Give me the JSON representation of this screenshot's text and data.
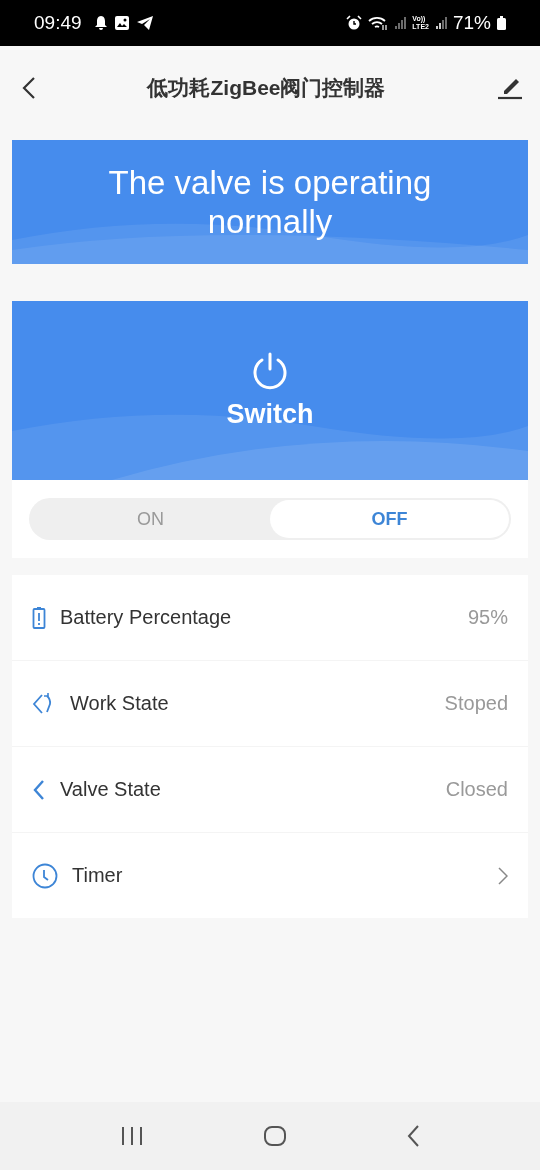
{
  "status_bar": {
    "time": "09:49",
    "network_label_top": "Vo))",
    "network_label_bottom": "LTE2",
    "battery": "71%"
  },
  "header": {
    "title": "低功耗ZigBee阀门控制器"
  },
  "banner": {
    "message": "The valve is operating normally"
  },
  "switch_card": {
    "label": "Switch"
  },
  "toggle": [
    {
      "label": "ON",
      "selected": false
    },
    {
      "label": "OFF",
      "selected": true
    }
  ],
  "rows": [
    {
      "kind": "value",
      "label": "Battery Percentage",
      "value": "95%"
    },
    {
      "kind": "value",
      "label": "Work State",
      "value": "Stoped"
    },
    {
      "kind": "value",
      "label": "Valve State",
      "value": "Closed"
    },
    {
      "kind": "link",
      "label": "Timer"
    }
  ]
}
